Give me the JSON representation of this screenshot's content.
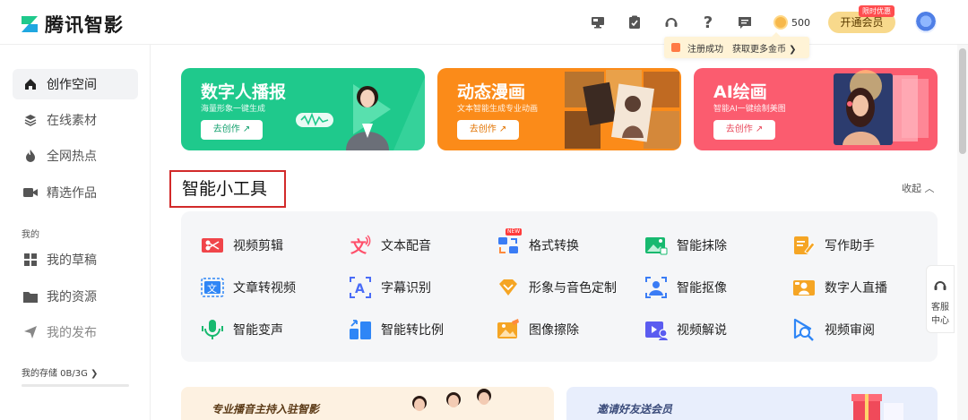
{
  "app": {
    "name": "腾讯智影"
  },
  "header": {
    "icons": [
      "monitor-icon",
      "clipboard-icon",
      "headset-icon",
      "help-icon",
      "message-icon"
    ],
    "coins": "500",
    "vip_button": "开通会员",
    "vip_badge": "限时优惠",
    "tooltip": {
      "text": "注册成功",
      "link": "获取更多金币 ❯"
    }
  },
  "sidebar": {
    "items": [
      {
        "label": "创作空间",
        "icon": "home-icon",
        "active": true
      },
      {
        "label": "在线素材",
        "icon": "layers-icon",
        "active": false
      },
      {
        "label": "全网热点",
        "icon": "flame-icon",
        "active": false
      },
      {
        "label": "精选作品",
        "icon": "video-camera-icon",
        "active": false
      }
    ],
    "section_label": "我的",
    "my_items": [
      {
        "label": "我的草稿",
        "icon": "grid-icon"
      },
      {
        "label": "我的资源",
        "icon": "folder-icon"
      },
      {
        "label": "我的发布",
        "icon": "send-icon"
      }
    ],
    "storage": "我的存储  0B/3G  ❯"
  },
  "banners": [
    {
      "title": "数字人播报",
      "subtitle": "海量形象一键生成",
      "button": "去创作 ↗",
      "color": "#1fc98c"
    },
    {
      "title": "动态漫画",
      "subtitle": "文本智能生成专业动画",
      "button": "去创作 ↗",
      "color": "#fb8b19"
    },
    {
      "title": "AI绘画",
      "subtitle": "智能AI一键绘制美图",
      "button": "去创作 ↗",
      "color": "#fb5c6f"
    }
  ],
  "tools_section": {
    "title": "智能小工具",
    "collapse": "收起 ︿",
    "tools": [
      {
        "label": "视频剪辑",
        "icon": "scissors-icon",
        "color": "#f0454a"
      },
      {
        "label": "文本配音",
        "icon": "text-voice-icon",
        "color": "#ff4f6a"
      },
      {
        "label": "格式转换",
        "icon": "format-convert-icon",
        "color": "#3a7cf5",
        "badge": "NEW"
      },
      {
        "label": "智能抹除",
        "icon": "image-erase-icon",
        "color": "#17b96f"
      },
      {
        "label": "写作助手",
        "icon": "pen-note-icon",
        "color": "#f5a524"
      },
      {
        "label": "文章转视频",
        "icon": "article-video-icon",
        "color": "#2f86f6"
      },
      {
        "label": "字幕识别",
        "icon": "subtitle-scan-icon",
        "color": "#4a6cf7"
      },
      {
        "label": "形象与音色定制",
        "icon": "diamond-icon",
        "color": "#f5a524"
      },
      {
        "label": "智能抠像",
        "icon": "portrait-cutout-icon",
        "color": "#3a7cf5"
      },
      {
        "label": "数字人直播",
        "icon": "live-avatar-icon",
        "color": "#f5a524"
      },
      {
        "label": "智能变声",
        "icon": "mic-icon",
        "color": "#17b96f"
      },
      {
        "label": "智能转比例",
        "icon": "ratio-icon",
        "color": "#2f86f6"
      },
      {
        "label": "图像擦除",
        "icon": "image-wipe-icon",
        "color": "#f5a524"
      },
      {
        "label": "视频解说",
        "icon": "video-narrate-icon",
        "color": "#5b5cf0"
      },
      {
        "label": "视频审阅",
        "icon": "video-review-icon",
        "color": "#2f86f6"
      }
    ]
  },
  "service": {
    "label_line1": "客服",
    "label_line2": "中心"
  },
  "cards": [
    {
      "title": "专业播音主持入驻智影"
    },
    {
      "title": "邀请好友送会员"
    }
  ]
}
